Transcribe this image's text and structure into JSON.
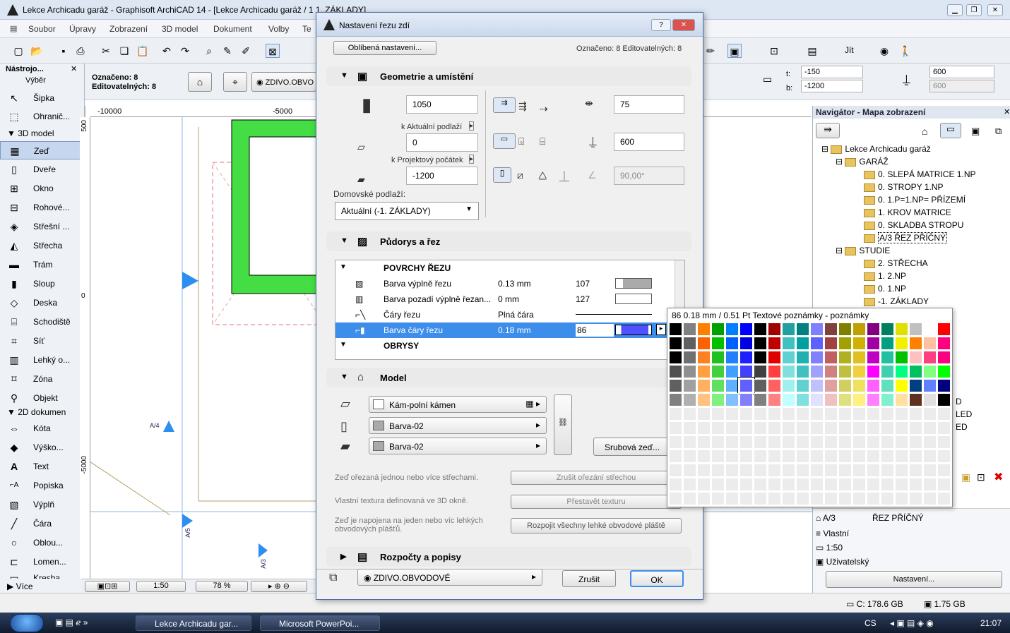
{
  "main_window": {
    "title": "Lekce Archicadu garáž - Graphisoft ArchiCAD 14 - [Lekce Archicadu garáž / 1 1. ZÁKLADY]",
    "menu": [
      "Soubor",
      "Úpravy",
      "Zobrazení",
      "3D model",
      "Dokument",
      "Volby",
      "Te"
    ],
    "toolbar_right_label": "Jít"
  },
  "infobox": {
    "marked_label": "Označeno: 8",
    "editable_label": "Editovatelných: 8",
    "layer": "ZDIVO.OBVO",
    "t_label": "t:",
    "b_label": "b:",
    "t_value": "-150",
    "b_value": "-1200",
    "height_value": "600",
    "height_value2": "600"
  },
  "toolbox": {
    "title": "Nástrojo...",
    "select": "Výběr",
    "items": [
      {
        "label": "Šipka",
        "icon": "arrow-icon"
      },
      {
        "label": "Ohranič...",
        "icon": "marquee-icon"
      }
    ],
    "group_3d": "3D model",
    "items_3d": [
      {
        "label": "Zeď",
        "icon": "wall-icon"
      },
      {
        "label": "Dveře",
        "icon": "door-icon"
      },
      {
        "label": "Okno",
        "icon": "window-icon"
      },
      {
        "label": "Rohové...",
        "icon": "corner-window-icon"
      },
      {
        "label": "Střešní ...",
        "icon": "skylight-icon"
      },
      {
        "label": "Střecha",
        "icon": "roof-icon"
      },
      {
        "label": "Trám",
        "icon": "beam-icon"
      },
      {
        "label": "Sloup",
        "icon": "column-icon"
      },
      {
        "label": "Deska",
        "icon": "slab-icon"
      },
      {
        "label": "Schodiště",
        "icon": "stair-icon"
      },
      {
        "label": "Síť",
        "icon": "mesh-icon"
      },
      {
        "label": "Lehký o...",
        "icon": "curtain-wall-icon"
      },
      {
        "label": "Zóna",
        "icon": "zone-icon"
      },
      {
        "label": "Objekt",
        "icon": "object-icon"
      }
    ],
    "group_2d": "2D dokumen",
    "items_2d": [
      {
        "label": "Kóta",
        "icon": "dimension-icon"
      },
      {
        "label": "Výško...",
        "icon": "level-dimension-icon"
      },
      {
        "label": "Text",
        "icon": "text-icon"
      },
      {
        "label": "Popiska",
        "icon": "label-icon"
      },
      {
        "label": "Výplň",
        "icon": "fill-icon"
      },
      {
        "label": "Čára",
        "icon": "line-icon"
      },
      {
        "label": "Oblou...",
        "icon": "arc-icon"
      },
      {
        "label": "Lomen...",
        "icon": "polyline-icon"
      },
      {
        "label": "Kresba",
        "icon": "drawing-icon"
      }
    ],
    "more": "Více"
  },
  "canvas": {
    "ruler_top": [
      "-10000",
      "-5000"
    ],
    "ruler_left": [
      "500",
      "0",
      "-5000"
    ],
    "markers": [
      "A/4",
      "A/5",
      "A/3"
    ],
    "scale": "1:50",
    "zoom": "78 %"
  },
  "navigator": {
    "title": "Navigátor - Mapa zobrazení",
    "root": "Lekce Archicadu garáž",
    "folder1": "GARÁŽ",
    "items1": [
      "0. SLEPÁ MATRICE 1.NP",
      "0. STROPY 1.NP",
      "0. 1.P=1.NP= PŘÍZEMÍ",
      "1. KROV MATRICE",
      "0. SKLADBA STROPU",
      "A/3 ŘEZ PŘÍČNÝ"
    ],
    "folder2": "STUDIE",
    "items2": [
      "2. STŘECHA",
      "1. 2.NP",
      "0. 1.NP",
      "-1. ZÁKLADY"
    ],
    "partial": [
      "D",
      "LED",
      "ED"
    ],
    "info_id": "A/3",
    "info_name": "ŘEZ PŘÍČNÝ",
    "info_layer": "Vlastní",
    "info_scale": "1:50",
    "info_model": "Uživatelský",
    "settings_btn": "Nastavení..."
  },
  "status": {
    "disk": "C: 178.6 GB",
    "ram": "1.75 GB"
  },
  "taskbar": {
    "tasks": [
      "Lekce Archicadu gar...",
      "Microsoft PowerPoi..."
    ],
    "lang": "CS",
    "clock": "21:07"
  },
  "dialog": {
    "title": "Nastavení řezu zdí",
    "favorites_btn": "Oblíbená nastavení...",
    "selection_info": "Označeno: 8 Editovatelných: 8",
    "section_geometry": "Geometrie a umístění",
    "height": "1050",
    "bottom_offset_label": "k Aktuální podlaží",
    "bottom_offset": "0",
    "project_zero_label": "k Projektový počátek",
    "project_zero": "-1200",
    "home_story_label": "Domovské podlaží:",
    "home_story": "Aktuální (-1. ZÁKLADY)",
    "thickness": "75",
    "thickness2": "600",
    "angle": "90,00°",
    "section_plan": "Půdorys a řez",
    "table_group1": "POVRCHY ŘEZU",
    "table_group2": "OBRYSY",
    "rows": [
      {
        "name": "Barva výplně řezu",
        "value": "0.13 mm",
        "num": "107"
      },
      {
        "name": "Barva pozadí výplně řezan...",
        "value": "0 mm",
        "num": "127"
      },
      {
        "name": "Čáry řezu",
        "value": "Plná čára",
        "num": ""
      },
      {
        "name": "Barva čáry řezu",
        "value": "0.18 mm",
        "num": "86"
      }
    ],
    "section_model": "Model",
    "material1": "Kám-polní kámen",
    "material2": "Barva-02",
    "material3": "Barva-02",
    "log_btn": "Srubová zeď...",
    "info1": "Zeď ořezaná jednou nebo více střechami.",
    "btn1": "Zrušit ořezání střechou",
    "info2": "Vlastní textura definovaná ve 3D okně.",
    "btn2": "Přestavět texturu",
    "info3": "Zeď je napojena na jeden nebo víc lehkých obvodových plášťů.",
    "btn3": "Rozpojit všechny lehké obvodové pláště",
    "section_listing": "Rozpočty a popisy",
    "layer": "ZDIVO.OBVODOVÉ",
    "cancel": "Zrušit",
    "ok": "OK"
  },
  "palette": {
    "title": "86  0.18 mm  /  0.51 Pt Textové poznámky - poznámky",
    "colors": [
      [
        "#000000",
        "#808080",
        "#ff8000",
        "#00a000",
        "#0080ff",
        "#0000ff",
        "#000000",
        "#a00000",
        "#20a0a0",
        "#008080",
        "#8080ff",
        "#804040",
        "#808000",
        "#c0a000",
        "#800080",
        "#008060",
        "#e0e000",
        "#c0c0c0",
        "#ffffff",
        "#ff0000"
      ],
      [
        "#000000",
        "#606060",
        "#ff6000",
        "#00c000",
        "#0060ff",
        "#0000e0",
        "#000000",
        "#c00000",
        "#40c0c0",
        "#00a0a0",
        "#6060ff",
        "#a04040",
        "#a0a000",
        "#d0b000",
        "#a000a0",
        "#00a080",
        "#f0f000",
        "#ff8000",
        "#ffc0a0",
        "#ff0080"
      ],
      [
        "#000000",
        "#707070",
        "#ff8020",
        "#20c020",
        "#2080ff",
        "#2020ff",
        "#000000",
        "#e00000",
        "#60d0d0",
        "#20b0b0",
        "#8080ff",
        "#c06060",
        "#b0b020",
        "#e0c020",
        "#c000c0",
        "#20c0a0",
        "#00c000",
        "#ffc0c0",
        "#ff4080",
        "#ff0080"
      ],
      [
        "#505050",
        "#909090",
        "#ffa040",
        "#40d040",
        "#40a0ff",
        "#4040ff",
        "#404040",
        "#ff4040",
        "#80e0e0",
        "#40c0c0",
        "#a0a0ff",
        "#d08080",
        "#c0c040",
        "#f0d040",
        "#ff00ff",
        "#40d0b0",
        "#00ff80",
        "#00c060",
        "#80ff80",
        "#00ff00"
      ],
      [
        "#606060",
        "#a0a0a0",
        "#ffb060",
        "#60e060",
        "#60b0ff",
        "#6060ff",
        "#606060",
        "#ff6060",
        "#a0f0f0",
        "#60d0d0",
        "#c0c0ff",
        "#e0a0a0",
        "#d0d060",
        "#f0e060",
        "#ff60ff",
        "#60e0c0",
        "#ffff00",
        "#004080",
        "#6080ff",
        "#000080"
      ],
      [
        "#808080",
        "#b0b0b0",
        "#ffc080",
        "#80f080",
        "#80c0ff",
        "#8080ff",
        "#808080",
        "#ff8080",
        "#c0ffff",
        "#80e0e0",
        "#e0e0ff",
        "#f0c0c0",
        "#e0e080",
        "#fff080",
        "#ff80ff",
        "#80f0d0",
        "#ffe0a0",
        "#603020",
        "#e0e0e0",
        "#000000"
      ]
    ]
  }
}
